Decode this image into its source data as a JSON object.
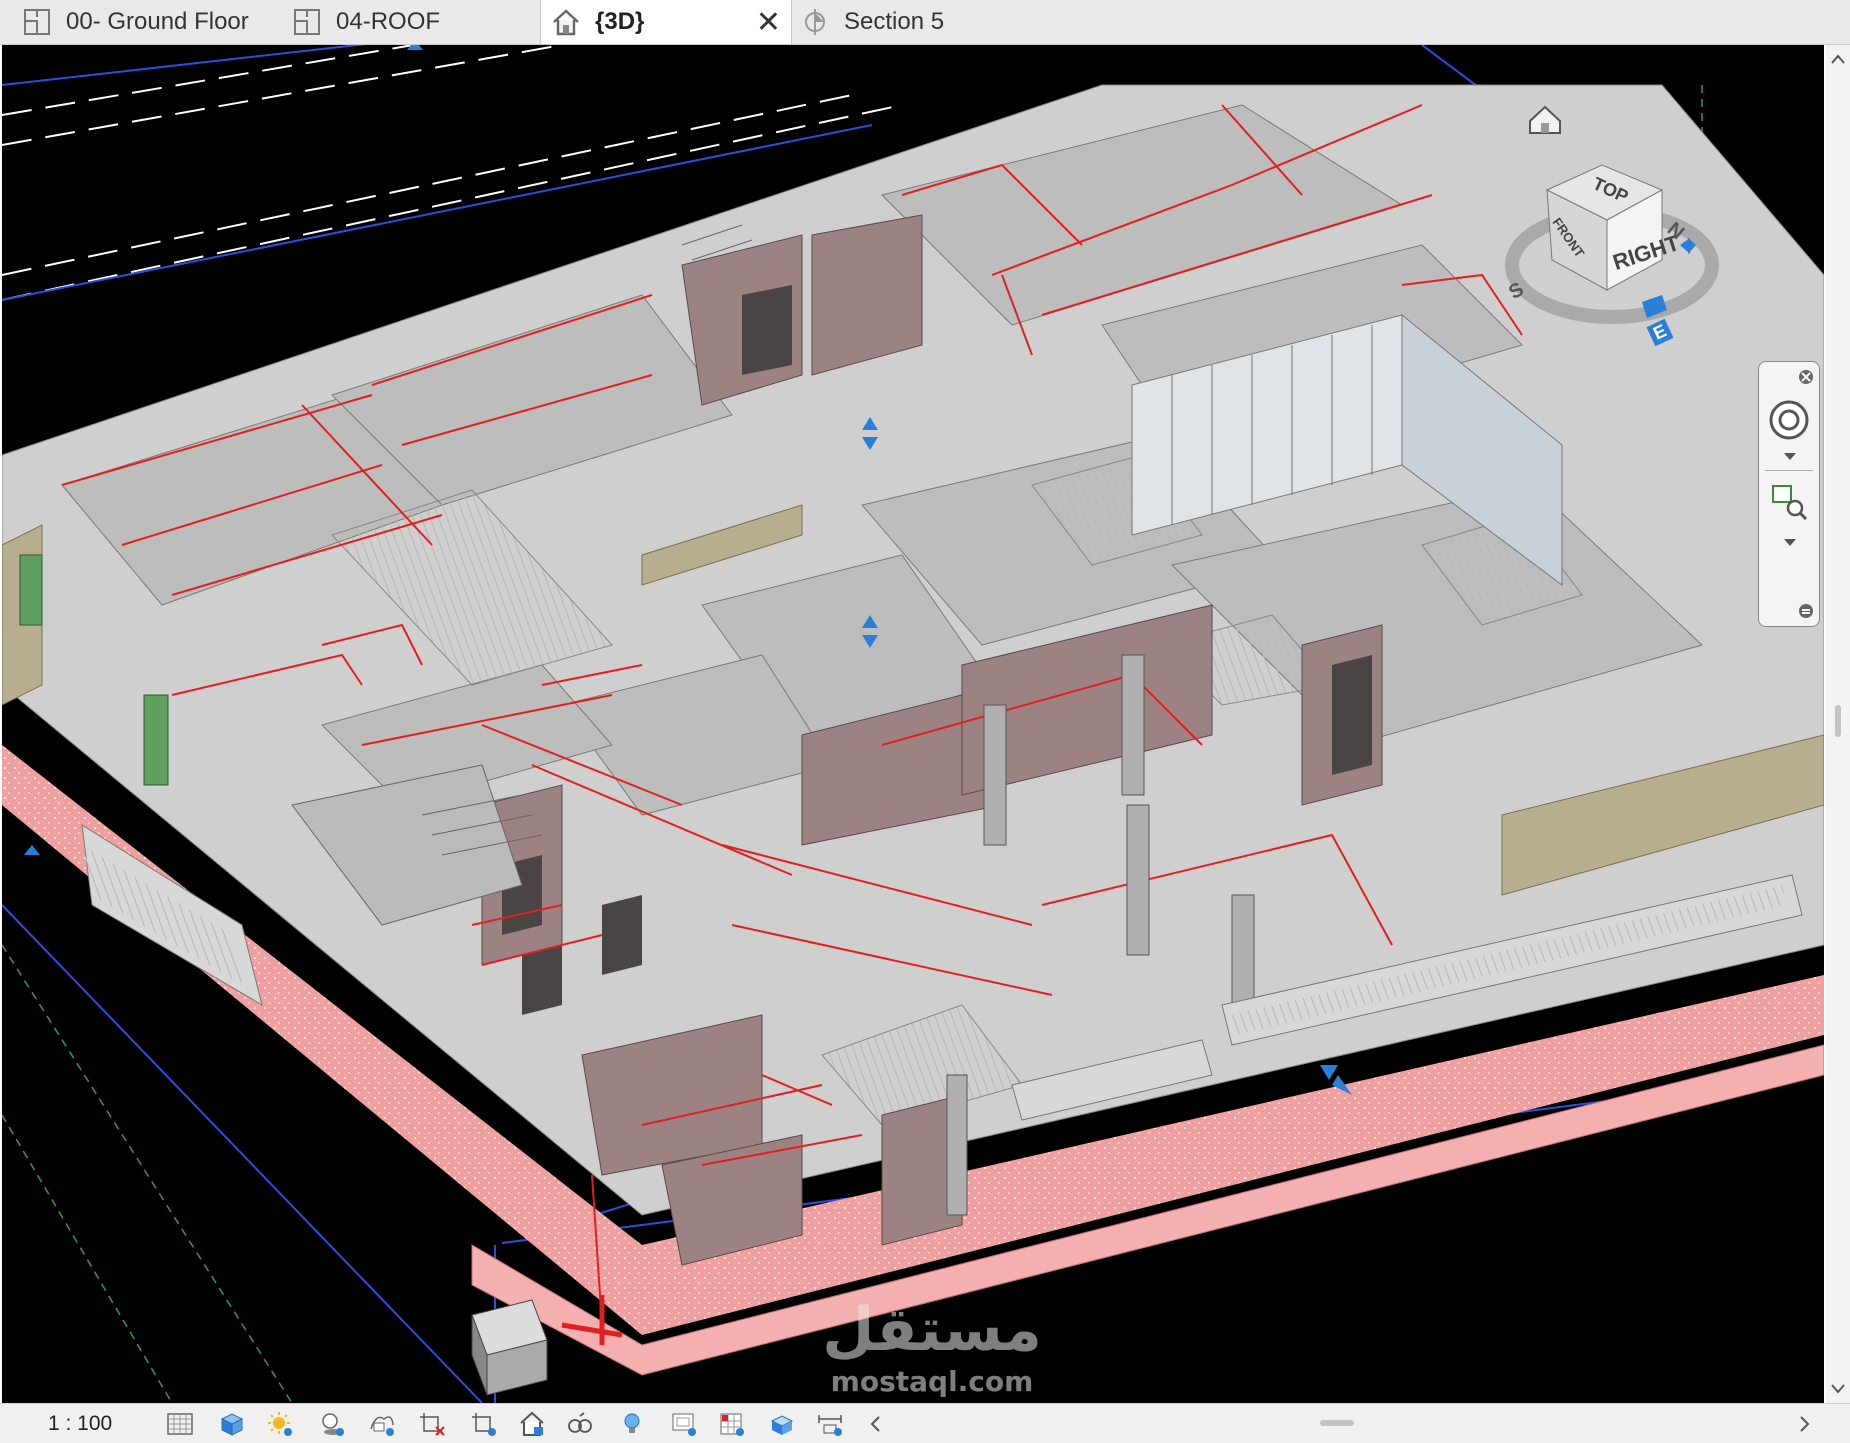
{
  "tabs": [
    {
      "label": "00- Ground Floor",
      "icon": "floor-plan-icon",
      "active": false
    },
    {
      "label": "04-ROOF",
      "icon": "floor-plan-icon",
      "active": false
    },
    {
      "label": "{3D}",
      "icon": "home-3d-icon",
      "active": true,
      "close": "✕"
    },
    {
      "label": "Section 5",
      "icon": "section-icon",
      "active": false
    }
  ],
  "viewcube": {
    "top": "TOP",
    "front": "FRONT",
    "right": "RIGHT",
    "compass": [
      "N",
      "S",
      "E"
    ]
  },
  "status_bar": {
    "scale": "1 : 100"
  },
  "watermark": {
    "arabic": "مستقل",
    "latin": "mostaql.com"
  },
  "colors": {
    "viewport_bg": "#000000",
    "pipes": "#e02020",
    "walls": "#9b8080",
    "floors": "#c9c9c9",
    "gridlines": "#1a3fd0"
  }
}
